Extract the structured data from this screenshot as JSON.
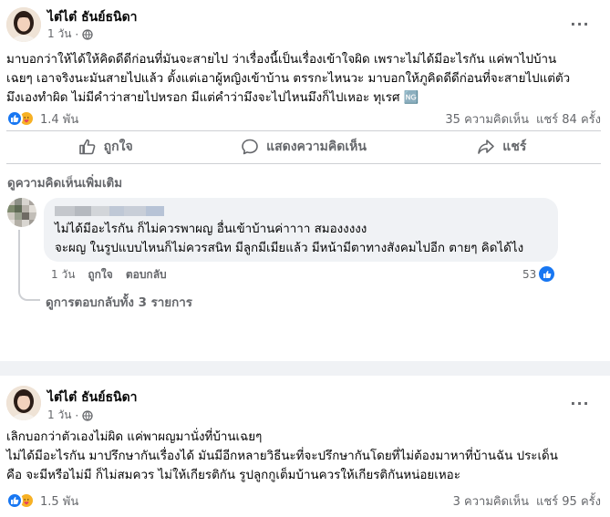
{
  "posts": [
    {
      "author": "ไต๋ไต๋ ธันย์ธนิดา",
      "time": "1 วัน",
      "text": "มาบอกว่าให้ได้ให้คิดดีดีก่อนที่มันจะสายไป ว่าเรื่องนี้เป็นเรื่องเข้าใจผิด เพราะไม่ได้มีอะไรกัน แค่พาไปบ้าน\nเฉยๆ เอาจริงนะมันสายไปแล้ว ตั้งแต่เอาผู้หญิงเข้าบ้าน ตรรกะไหนวะ มาบอกให้ภูคิดดีดีก่อนที่จะสายไปแต่ตัว\nมึงเองทำผิด ไม่มีคำว่าสายไปหรอก มีแต่คำว่ามึงจะไปไหนมึงก็ไปเหอะ ทุเรศ 🆖",
      "reactions": "1.4 พัน",
      "comments": "35 ความคิดเห็น",
      "shares": "แชร์ 84 ครั้ง",
      "actions": {
        "like": "ถูกใจ",
        "comment": "แสดงความคิดเห็น",
        "share": "แชร์"
      },
      "more_comments": "ดูความคิดเห็นเพิ่มเติม",
      "comment": {
        "text": "ไม่ได้มีอะไรกัน ก็ไม่ควรพาผญ อื่นเข้าบ้านค่าาาา สมองงงงง\nจะผญ ในรูปแบบไหนก็ไม่ควรสนิท มีลูกมีเมียแล้ว มีหน้ามีตาทางสังคมไปอีก ตายๆ คิดได้ไง",
        "time": "1 วัน",
        "like": "ถูกใจ",
        "reply": "ตอบกลับ",
        "reactions": "53",
        "view_replies": "ดูการตอบกลับทั้ง 3 รายการ"
      }
    },
    {
      "author": "ไต๋ไต๋ ธันย์ธนิดา",
      "time": "1 วัน",
      "text": "เลิกบอกว่าตัวเองไม่ผิด แค่พาผญมานั่งที่บ้านเฉยๆ\nไม่ได้มีอะไรกัน มาปรึกษากันเรื่องได้ มันมีอีกหลายวิธีนะที่จะปรึกษากันโดยที่ไม่ต้องมาหาที่บ้านฉัน  ประเด็น\nคือ จะมีหรือไม่มี ก็ไม่สมควร ไม่ให้เกียรติกัน รูปลูกกูเต็มบ้านควรให้เกียรติกันหน่อยเหอะ",
      "reactions": "1.5 พัน",
      "comments": "3 ความคิดเห็น",
      "shares": "แชร์ 95 ครั้ง"
    }
  ],
  "icons": {
    "globe": "globe-icon",
    "more": "more-options-icon",
    "like": "like-reaction-icon",
    "care": "care-reaction-icon",
    "thumb": "thumbs-up-icon",
    "comment": "comment-bubble-icon",
    "share": "share-arrow-icon"
  },
  "colors": {
    "brand_blue": "#1877f2",
    "muted_text": "#65676b",
    "background": "#f0f2f5"
  }
}
